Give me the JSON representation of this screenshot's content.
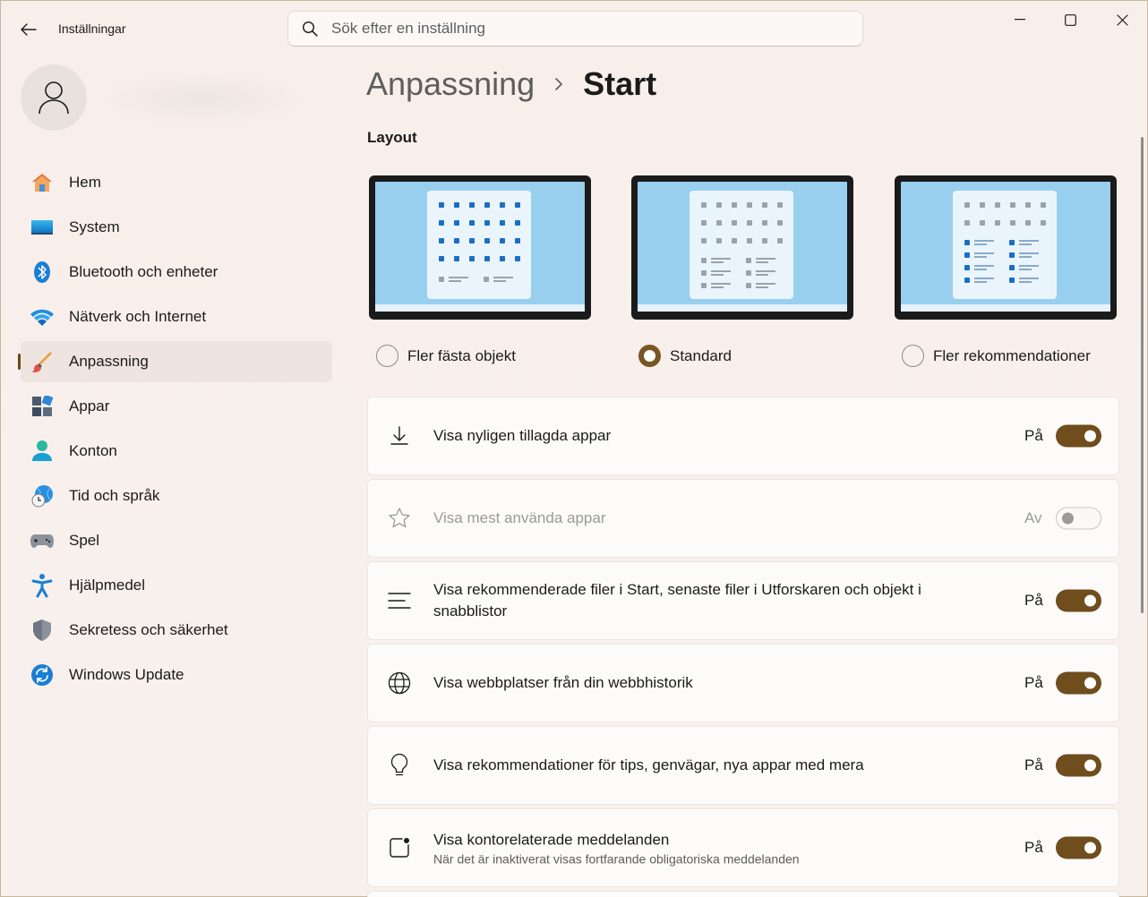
{
  "app": {
    "title": "Inställningar"
  },
  "search": {
    "placeholder": "Sök efter en inställning"
  },
  "sidebar": {
    "items": [
      {
        "label": "Hem",
        "icon": "home-icon"
      },
      {
        "label": "System",
        "icon": "system-icon"
      },
      {
        "label": "Bluetooth och enheter",
        "icon": "bluetooth-icon"
      },
      {
        "label": "Nätverk och Internet",
        "icon": "wifi-icon"
      },
      {
        "label": "Anpassning",
        "icon": "brush-icon",
        "active": true
      },
      {
        "label": "Appar",
        "icon": "apps-icon"
      },
      {
        "label": "Konton",
        "icon": "account-icon"
      },
      {
        "label": "Tid och språk",
        "icon": "time-language-icon"
      },
      {
        "label": "Spel",
        "icon": "gamepad-icon"
      },
      {
        "label": "Hjälpmedel",
        "icon": "accessibility-icon"
      },
      {
        "label": "Sekretess och säkerhet",
        "icon": "shield-icon"
      },
      {
        "label": "Windows Update",
        "icon": "update-icon"
      }
    ]
  },
  "breadcrumb": {
    "parent": "Anpassning",
    "current": "Start"
  },
  "layout": {
    "title": "Layout",
    "options": [
      {
        "label": "Fler fästa objekt",
        "checked": false
      },
      {
        "label": "Standard",
        "checked": true
      },
      {
        "label": "Fler rekommendationer",
        "checked": false
      }
    ]
  },
  "settings": [
    {
      "title": "Visa nyligen tillagda appar",
      "state": "På",
      "on": true,
      "icon": "download-icon"
    },
    {
      "title": "Visa mest använda appar",
      "state": "Av",
      "on": false,
      "disabled": true,
      "icon": "star-icon"
    },
    {
      "title": "Visa rekommenderade filer i Start, senaste filer i Utforskaren och objekt i snabblistor",
      "state": "På",
      "on": true,
      "icon": "list-icon"
    },
    {
      "title": "Visa webbplatser från din webbhistorik",
      "state": "På",
      "on": true,
      "icon": "globe-icon"
    },
    {
      "title": "Visa rekommendationer för tips, genvägar, nya appar med mera",
      "state": "På",
      "on": true,
      "icon": "lightbulb-icon"
    },
    {
      "title": "Visa kontorelaterade meddelanden",
      "subtitle": "När det är inaktiverat visas fortfarande obligatoriska meddelanden",
      "state": "På",
      "on": true,
      "icon": "notification-icon"
    }
  ],
  "colors": {
    "accent": "#6f4d1c",
    "background": "#f7efea"
  }
}
